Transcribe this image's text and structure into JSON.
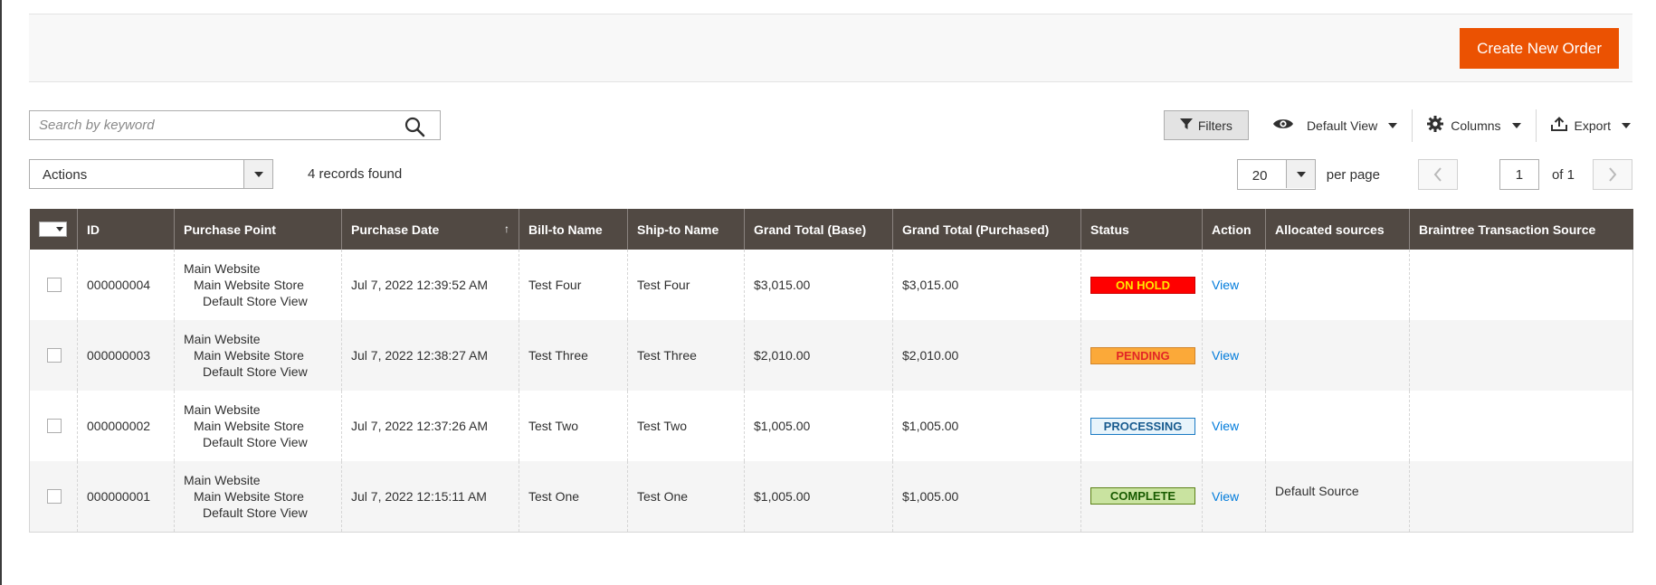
{
  "header": {
    "create_button": "Create New Order"
  },
  "search": {
    "placeholder": "Search by keyword"
  },
  "toolbar": {
    "filters": "Filters",
    "view": "Default View",
    "columns": "Columns",
    "export": "Export"
  },
  "mass_actions": {
    "label": "Actions"
  },
  "records_found": "4 records found",
  "pagination": {
    "per_page_value": "20",
    "per_page_label": "per page",
    "current_page": "1",
    "of_label": "of 1"
  },
  "columns": [
    "ID",
    "Purchase Point",
    "Purchase Date",
    "Bill-to Name",
    "Ship-to Name",
    "Grand Total (Base)",
    "Grand Total (Purchased)",
    "Status",
    "Action",
    "Allocated sources",
    "Braintree Transaction Source"
  ],
  "sort_indicator": "↑",
  "rows": [
    {
      "id": "000000004",
      "purchase_point": [
        "Main Website",
        "Main Website Store",
        "Default Store View"
      ],
      "date": "Jul 7, 2022 12:39:52 AM",
      "bill_to": "Test Four",
      "ship_to": "Test Four",
      "total_base": "$3,015.00",
      "total_purchased": "$3,015.00",
      "status": "ON HOLD",
      "action": "View",
      "allocated": "",
      "braintree": ""
    },
    {
      "id": "000000003",
      "purchase_point": [
        "Main Website",
        "Main Website Store",
        "Default Store View"
      ],
      "date": "Jul 7, 2022 12:38:27 AM",
      "bill_to": "Test Three",
      "ship_to": "Test Three",
      "total_base": "$2,010.00",
      "total_purchased": "$2,010.00",
      "status": "PENDING",
      "action": "View",
      "allocated": "",
      "braintree": ""
    },
    {
      "id": "000000002",
      "purchase_point": [
        "Main Website",
        "Main Website Store",
        "Default Store View"
      ],
      "date": "Jul 7, 2022 12:37:26 AM",
      "bill_to": "Test Two",
      "ship_to": "Test Two",
      "total_base": "$1,005.00",
      "total_purchased": "$1,005.00",
      "status": "PROCESSING",
      "action": "View",
      "allocated": "",
      "braintree": ""
    },
    {
      "id": "000000001",
      "purchase_point": [
        "Main Website",
        "Main Website Store",
        "Default Store View"
      ],
      "date": "Jul 7, 2022 12:15:11 AM",
      "bill_to": "Test One",
      "ship_to": "Test One",
      "total_base": "$1,005.00",
      "total_purchased": "$1,005.00",
      "status": "COMPLETE",
      "action": "View",
      "allocated": "Default Source",
      "braintree": ""
    }
  ],
  "colors": {
    "primary": "#eb5202",
    "header_bg": "#514943",
    "link": "#007bdb",
    "status_on_hold": "#ff0000",
    "status_pending": "#fba939",
    "status_processing": "#e8f4fb",
    "status_complete": "#c9e3a0"
  }
}
